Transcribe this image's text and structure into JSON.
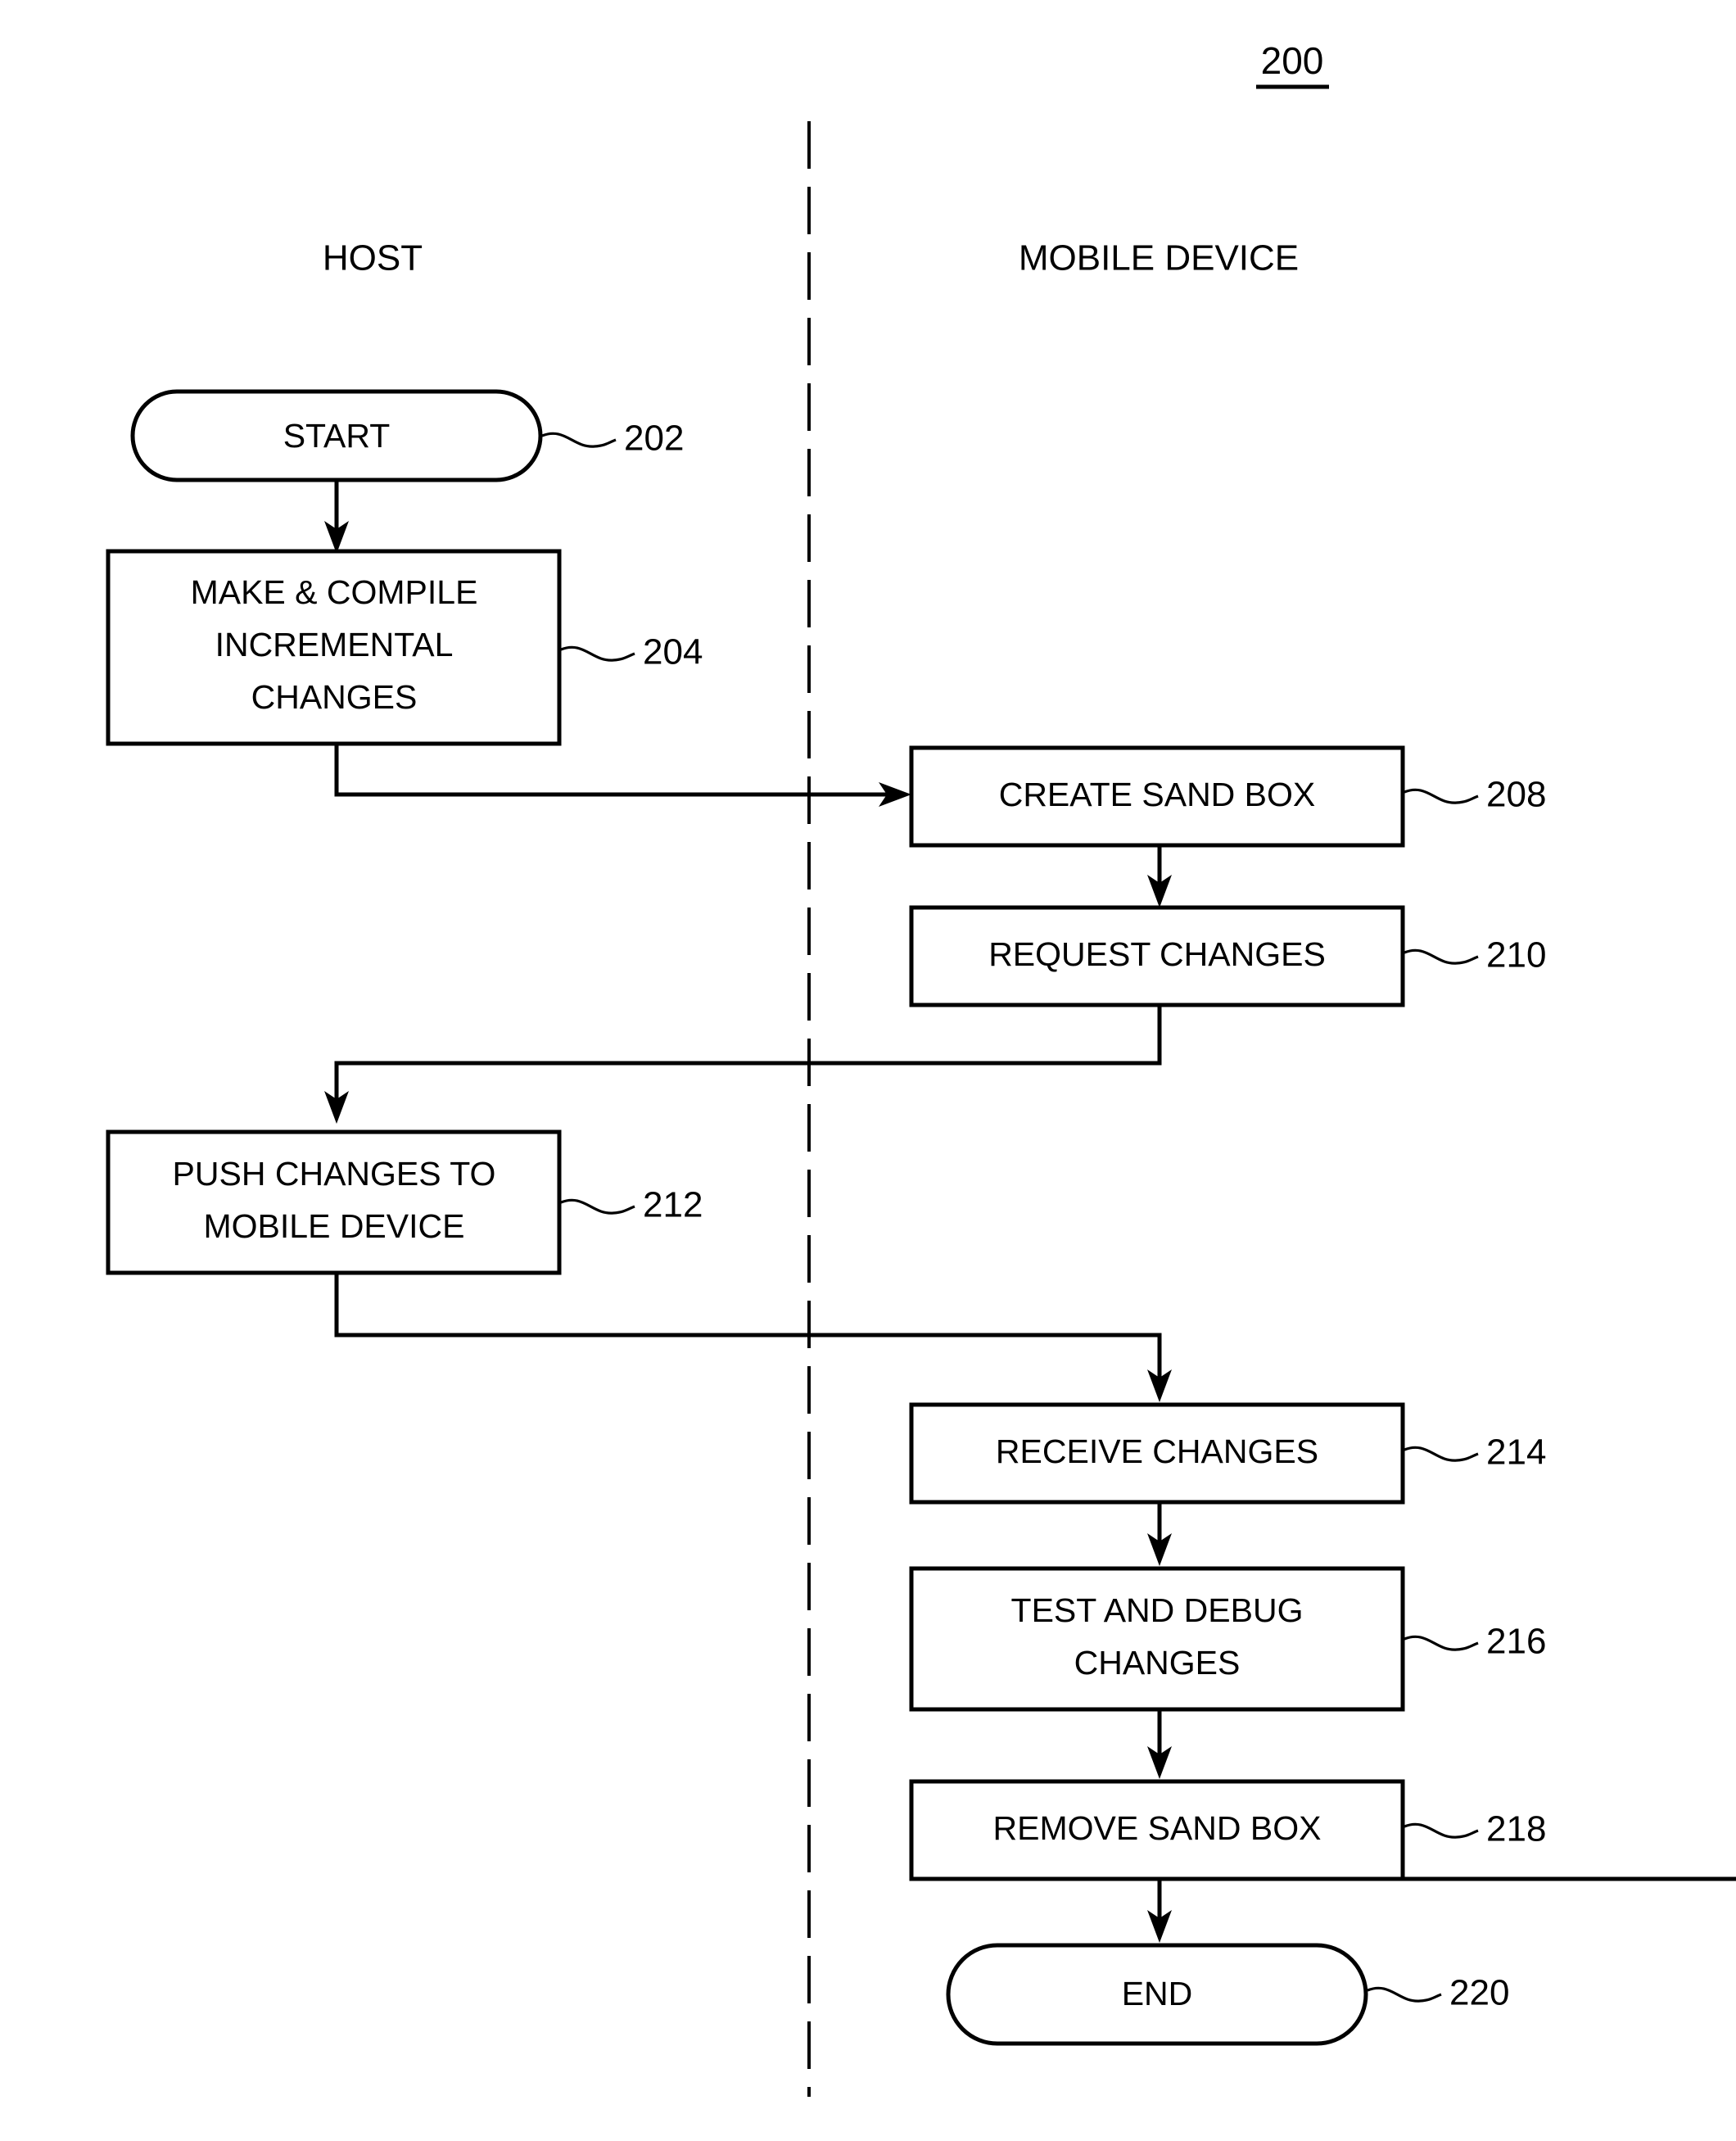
{
  "figure": {
    "number": "200",
    "underlined": true
  },
  "lanes": [
    {
      "id": "host",
      "label": "HOST"
    },
    {
      "id": "mobile",
      "label": "MOBILE DEVICE"
    }
  ],
  "divider": {
    "style": "dashed",
    "color": "#000000"
  },
  "colors": {
    "stroke": "#000000",
    "fill": "#ffffff",
    "background": "#ffffff"
  },
  "nodes": [
    {
      "id": "start",
      "lane": "host",
      "shape": "terminal",
      "lines": [
        "START"
      ],
      "ref": "202"
    },
    {
      "id": "make_compile",
      "lane": "host",
      "shape": "process",
      "lines": [
        "MAKE & COMPILE",
        "INCREMENTAL",
        "CHANGES"
      ],
      "ref": "204"
    },
    {
      "id": "create_sandbox",
      "lane": "mobile",
      "shape": "process",
      "lines": [
        "CREATE SAND BOX"
      ],
      "ref": "208"
    },
    {
      "id": "request_changes",
      "lane": "mobile",
      "shape": "process",
      "lines": [
        "REQUEST CHANGES"
      ],
      "ref": "210"
    },
    {
      "id": "push_changes",
      "lane": "host",
      "shape": "process",
      "lines": [
        "PUSH CHANGES TO",
        "MOBILE DEVICE"
      ],
      "ref": "212"
    },
    {
      "id": "receive_changes",
      "lane": "mobile",
      "shape": "process",
      "lines": [
        "RECEIVE CHANGES"
      ],
      "ref": "214"
    },
    {
      "id": "test_debug",
      "lane": "mobile",
      "shape": "process",
      "lines": [
        "TEST AND DEBUG",
        "CHANGES"
      ],
      "ref": "216"
    },
    {
      "id": "remove_sandbox",
      "lane": "mobile",
      "shape": "process",
      "lines": [
        "REMOVE SAND BOX"
      ],
      "ref": "218"
    },
    {
      "id": "end",
      "lane": "mobile",
      "shape": "terminal",
      "lines": [
        "END"
      ],
      "ref": "220"
    }
  ],
  "edges": [
    {
      "from": "start",
      "to": "make_compile",
      "routing": "straight-down"
    },
    {
      "from": "make_compile",
      "to": "create_sandbox",
      "routing": "down-right-into-left"
    },
    {
      "from": "create_sandbox",
      "to": "request_changes",
      "routing": "straight-down"
    },
    {
      "from": "request_changes",
      "to": "push_changes",
      "routing": "down-left-down"
    },
    {
      "from": "push_changes",
      "to": "receive_changes",
      "routing": "down-right-down"
    },
    {
      "from": "receive_changes",
      "to": "test_debug",
      "routing": "straight-down"
    },
    {
      "from": "test_debug",
      "to": "remove_sandbox",
      "routing": "straight-down"
    },
    {
      "from": "remove_sandbox",
      "to": "end",
      "routing": "straight-down"
    }
  ]
}
